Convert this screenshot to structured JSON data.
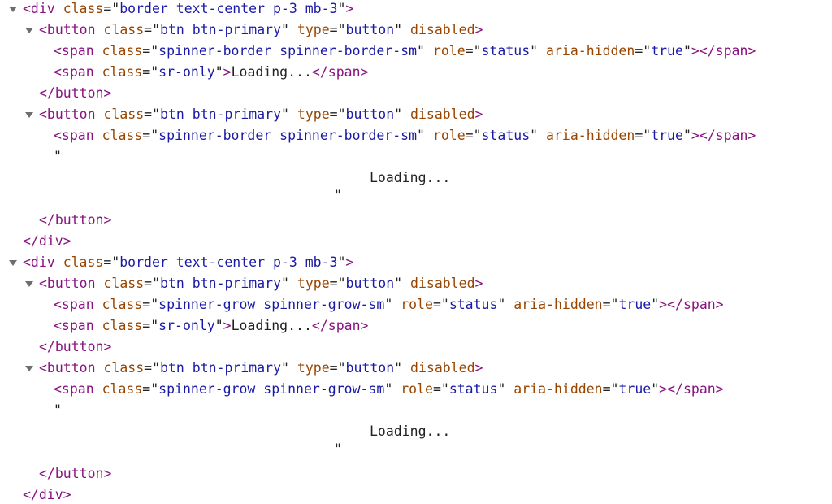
{
  "tree": [
    {
      "indent": 0,
      "arrow": true,
      "kind": "open",
      "tag": "div",
      "attrs": [
        {
          "n": "class",
          "v": "border text-center p-3 mb-3"
        }
      ]
    },
    {
      "indent": 1,
      "arrow": true,
      "kind": "open",
      "tag": "button",
      "attrs": [
        {
          "n": "class",
          "v": "btn btn-primary"
        },
        {
          "n": "type",
          "v": "button"
        },
        {
          "n": "disabled",
          "v": null
        }
      ]
    },
    {
      "indent": 2,
      "arrow": false,
      "kind": "inline",
      "tag": "span",
      "attrs": [
        {
          "n": "class",
          "v": "spinner-border spinner-border-sm"
        },
        {
          "n": "role",
          "v": "status"
        },
        {
          "n": "aria-hidden",
          "v": "true"
        }
      ],
      "text": ""
    },
    {
      "indent": 2,
      "arrow": false,
      "kind": "inline",
      "tag": "span",
      "attrs": [
        {
          "n": "class",
          "v": "sr-only"
        }
      ],
      "text": "Loading..."
    },
    {
      "indent": 1,
      "arrow": false,
      "kind": "close",
      "tag": "button"
    },
    {
      "indent": 1,
      "arrow": true,
      "kind": "open",
      "tag": "button",
      "attrs": [
        {
          "n": "class",
          "v": "btn btn-primary"
        },
        {
          "n": "type",
          "v": "button"
        },
        {
          "n": "disabled",
          "v": null
        }
      ]
    },
    {
      "indent": 2,
      "arrow": false,
      "kind": "inline",
      "tag": "span",
      "attrs": [
        {
          "n": "class",
          "v": "spinner-border spinner-border-sm"
        },
        {
          "n": "role",
          "v": "status"
        },
        {
          "n": "aria-hidden",
          "v": "true"
        }
      ],
      "text": ""
    },
    {
      "indent": 2,
      "arrow": false,
      "kind": "textnode",
      "text": "\"\n                       Loading...\n                    \"",
      "tail": ""
    },
    {
      "indent": 1,
      "arrow": false,
      "kind": "close",
      "tag": "button"
    },
    {
      "indent": 0,
      "arrow": false,
      "kind": "close",
      "tag": "div"
    },
    {
      "indent": 0,
      "arrow": true,
      "kind": "open",
      "tag": "div",
      "attrs": [
        {
          "n": "class",
          "v": "border text-center p-3 mb-3"
        }
      ]
    },
    {
      "indent": 1,
      "arrow": true,
      "kind": "open",
      "tag": "button",
      "attrs": [
        {
          "n": "class",
          "v": "btn btn-primary"
        },
        {
          "n": "type",
          "v": "button"
        },
        {
          "n": "disabled",
          "v": null
        }
      ]
    },
    {
      "indent": 2,
      "arrow": false,
      "kind": "inline",
      "tag": "span",
      "attrs": [
        {
          "n": "class",
          "v": "spinner-grow spinner-grow-sm"
        },
        {
          "n": "role",
          "v": "status"
        },
        {
          "n": "aria-hidden",
          "v": "true"
        }
      ],
      "text": ""
    },
    {
      "indent": 2,
      "arrow": false,
      "kind": "inline",
      "tag": "span",
      "attrs": [
        {
          "n": "class",
          "v": "sr-only"
        }
      ],
      "text": "Loading..."
    },
    {
      "indent": 1,
      "arrow": false,
      "kind": "close",
      "tag": "button"
    },
    {
      "indent": 1,
      "arrow": true,
      "kind": "open",
      "tag": "button",
      "attrs": [
        {
          "n": "class",
          "v": "btn btn-primary"
        },
        {
          "n": "type",
          "v": "button"
        },
        {
          "n": "disabled",
          "v": null
        }
      ]
    },
    {
      "indent": 2,
      "arrow": false,
      "kind": "inline",
      "tag": "span",
      "attrs": [
        {
          "n": "class",
          "v": "spinner-grow spinner-grow-sm"
        },
        {
          "n": "role",
          "v": "status"
        },
        {
          "n": "aria-hidden",
          "v": "true"
        }
      ],
      "text": ""
    },
    {
      "indent": 2,
      "arrow": false,
      "kind": "textnode",
      "text": "\"\n                       Loading...\n                    \"",
      "tail": ""
    },
    {
      "indent": 1,
      "arrow": false,
      "kind": "close",
      "tag": "button"
    },
    {
      "indent": 0,
      "arrow": false,
      "kind": "close",
      "tag": "div"
    }
  ]
}
